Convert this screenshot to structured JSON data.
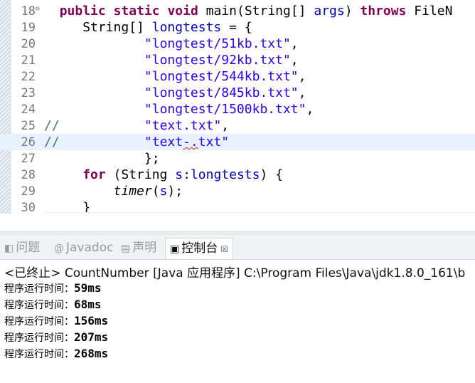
{
  "editor": {
    "lines": [
      {
        "num": "18",
        "fold": "⊖",
        "indent": "  ",
        "tokens": [
          {
            "t": "public",
            "c": "kw"
          },
          {
            "t": " ",
            "c": ""
          },
          {
            "t": "static",
            "c": "kw"
          },
          {
            "t": " ",
            "c": ""
          },
          {
            "t": "void",
            "c": "kw"
          },
          {
            "t": " main(String[] ",
            "c": ""
          },
          {
            "t": "args",
            "c": "fld"
          },
          {
            "t": ") ",
            "c": ""
          },
          {
            "t": "throws",
            "c": "kw"
          },
          {
            "t": " FileN",
            "c": ""
          }
        ]
      },
      {
        "num": "19",
        "indent": "     ",
        "tokens": [
          {
            "t": "String[] ",
            "c": ""
          },
          {
            "t": "longtests",
            "c": "fld"
          },
          {
            "t": " = {",
            "c": ""
          }
        ]
      },
      {
        "num": "20",
        "indent": "             ",
        "tokens": [
          {
            "t": "\"longtest/51kb.txt\"",
            "c": "str"
          },
          {
            "t": ",",
            "c": ""
          }
        ]
      },
      {
        "num": "21",
        "indent": "             ",
        "tokens": [
          {
            "t": "\"longtest/92kb.txt\"",
            "c": "str"
          },
          {
            "t": ",",
            "c": ""
          }
        ]
      },
      {
        "num": "22",
        "indent": "             ",
        "tokens": [
          {
            "t": "\"longtest/544kb.txt\"",
            "c": "str"
          },
          {
            "t": ",",
            "c": ""
          }
        ]
      },
      {
        "num": "23",
        "indent": "             ",
        "tokens": [
          {
            "t": "\"longtest/845kb.txt\"",
            "c": "str"
          },
          {
            "t": ",",
            "c": ""
          }
        ]
      },
      {
        "num": "24",
        "indent": "             ",
        "tokens": [
          {
            "t": "\"longtest/1500kb.txt\"",
            "c": "str"
          },
          {
            "t": ",",
            "c": ""
          }
        ]
      },
      {
        "num": "25",
        "indent": "",
        "tokens": [
          {
            "t": "//",
            "c": "cmt"
          },
          {
            "t": "           ",
            "c": ""
          },
          {
            "t": "\"text.txt\"",
            "c": "str"
          },
          {
            "t": ",",
            "c": ""
          }
        ]
      },
      {
        "num": "26",
        "indent": "",
        "hl": true,
        "tokens": [
          {
            "t": "//",
            "c": "cmt"
          },
          {
            "t": "           ",
            "c": ""
          },
          {
            "t": "\"text",
            "c": "str"
          },
          {
            "t": "-.",
            "c": "str sq"
          },
          {
            "t": "txt\"",
            "c": "str"
          }
        ]
      },
      {
        "num": "27",
        "indent": "             ",
        "tokens": [
          {
            "t": "};",
            "c": ""
          }
        ]
      },
      {
        "num": "28",
        "indent": "     ",
        "tokens": [
          {
            "t": "for",
            "c": "kw"
          },
          {
            "t": " (String ",
            "c": ""
          },
          {
            "t": "s",
            "c": "fld"
          },
          {
            "t": ":",
            "c": ""
          },
          {
            "t": "longtests",
            "c": "fld"
          },
          {
            "t": ") {",
            "c": ""
          }
        ]
      },
      {
        "num": "29",
        "indent": "         ",
        "tokens": [
          {
            "t": "timer",
            "c": "ital"
          },
          {
            "t": "(",
            "c": ""
          },
          {
            "t": "s",
            "c": "fld"
          },
          {
            "t": ");",
            "c": ""
          }
        ]
      },
      {
        "num": "30",
        "indent": "     ",
        "tokens": [
          {
            "t": "}",
            "c": ""
          }
        ]
      }
    ],
    "scroll_left_icon": "chevron-left-icon",
    "scroll_left_glyph": "<"
  },
  "tabs": [
    {
      "label": "问题",
      "icon": "problems-icon",
      "glyph": "◧",
      "active": false
    },
    {
      "label": "Javadoc",
      "icon": "javadoc-icon",
      "glyph": "@",
      "active": false
    },
    {
      "label": "声明",
      "icon": "declaration-icon",
      "glyph": "▤",
      "active": false
    },
    {
      "label": "控制台",
      "icon": "console-icon",
      "glyph": "▣",
      "active": true,
      "close": "☒"
    }
  ],
  "console": {
    "terminated": "<已终止> CountNumber [Java 应用程序] C:\\Program Files\\Java\\jdk1.8.0_161\\b",
    "label": "程序运行时间：",
    "results": [
      "59ms",
      "68ms",
      "156ms",
      "207ms",
      "268ms"
    ]
  }
}
